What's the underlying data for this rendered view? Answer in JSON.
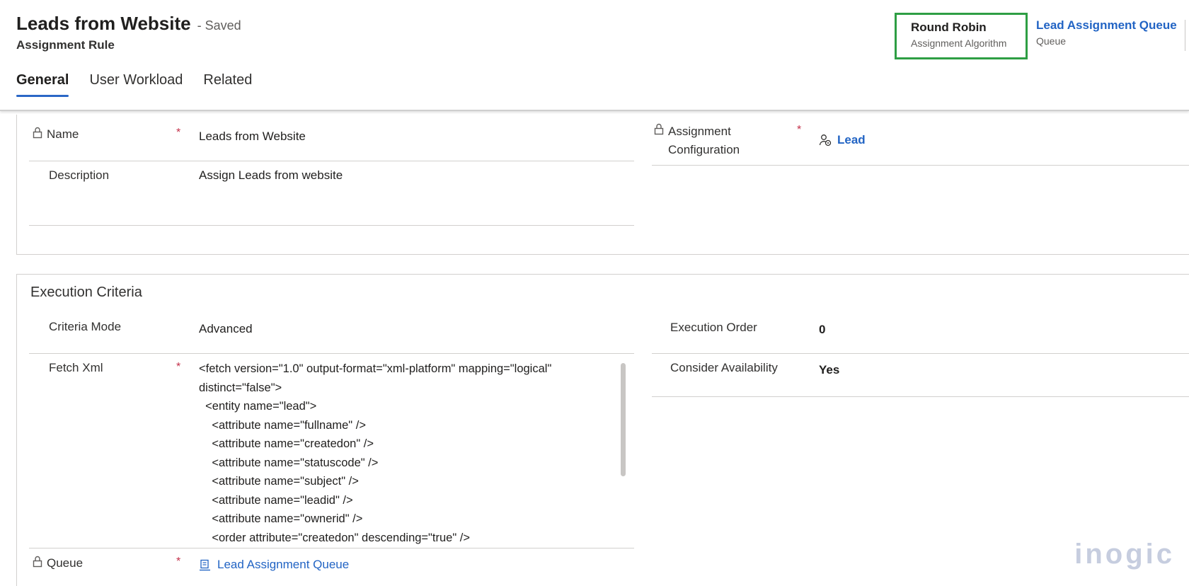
{
  "header": {
    "title": "Leads from Website",
    "saved": "- Saved",
    "entity": "Assignment Rule",
    "fields": [
      {
        "value": "Round Robin",
        "label": "Assignment Algorithm"
      },
      {
        "value": "Lead Assignment Queue",
        "label": "Queue"
      }
    ]
  },
  "tabs": [
    "General",
    "User Workload",
    "Related"
  ],
  "general": {
    "name_label": "Name",
    "name_value": "Leads from Website",
    "description_label": "Description",
    "description_value": "Assign Leads from website",
    "assignment_config_label_1": "Assignment",
    "assignment_config_label_2": "Configuration",
    "assignment_config_value": "Lead"
  },
  "execution": {
    "title": "Execution Criteria",
    "criteria_mode_label": "Criteria Mode",
    "criteria_mode_value": "Advanced",
    "fetch_xml_label": "Fetch Xml",
    "fetch_xml_value": "<fetch version=\"1.0\" output-format=\"xml-platform\" mapping=\"logical\"\ndistinct=\"false\">\n  <entity name=\"lead\">\n    <attribute name=\"fullname\" />\n    <attribute name=\"createdon\" />\n    <attribute name=\"statuscode\" />\n    <attribute name=\"subject\" />\n    <attribute name=\"leadid\" />\n    <attribute name=\"ownerid\" />\n    <order attribute=\"createdon\" descending=\"true\" />",
    "queue_label": "Queue",
    "queue_value": "Lead Assignment Queue",
    "execution_order_label": "Execution Order",
    "execution_order_value": "0",
    "consider_availability_label": "Consider Availability",
    "consider_availability_value": "Yes"
  },
  "required_marker": "*",
  "watermark": "inogic",
  "colors": {
    "accent": "#2b67c6",
    "link": "#2264c4",
    "highlight": "#2e9e44",
    "required": "#c4314b"
  }
}
